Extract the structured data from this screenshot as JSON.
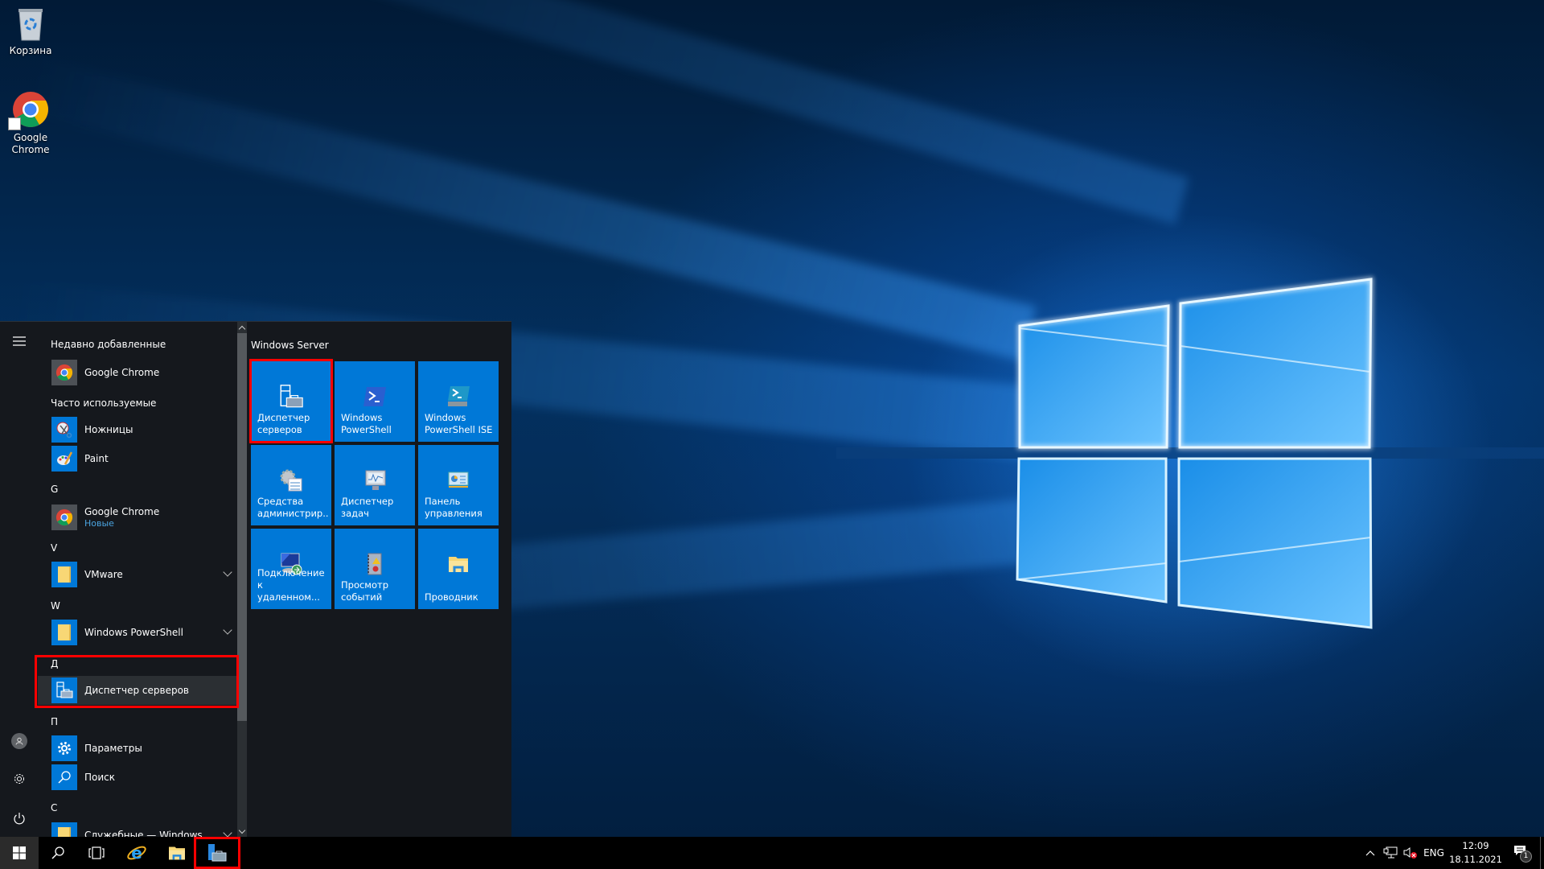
{
  "desktop": {
    "icons": [
      {
        "label": "Корзина",
        "icon": "recycle-bin-icon"
      },
      {
        "label": "Google\nChrome",
        "icon": "chrome-shortcut-icon"
      }
    ]
  },
  "start_menu": {
    "left_strip": {
      "menu": "hamburger-icon",
      "user": "user-avatar-icon",
      "settings": "gear-icon",
      "power": "power-icon"
    },
    "sections": {
      "recent": "Недавно добавленные",
      "frequent": "Часто используемые",
      "g": "G",
      "v": "V",
      "w": "W",
      "d": "Д",
      "p": "П",
      "s": "С"
    },
    "items": {
      "recent_chrome": "Google Chrome",
      "snipping": "Ножницы",
      "paint": "Paint",
      "g_chrome": "Google Chrome",
      "g_chrome_badge": "Новые",
      "vmware": "VMware",
      "powershell_folder": "Windows PowerShell",
      "server_manager": "Диспетчер серверов",
      "settings": "Параметры",
      "search": "Поиск",
      "accessories": "Служебные — Windows"
    },
    "tiles_group": "Windows Server",
    "tiles": [
      {
        "label": "Диспетчер\nсерверов",
        "icon": "server-manager-icon"
      },
      {
        "label": "Windows\nPowerShell",
        "icon": "powershell-icon"
      },
      {
        "label": "Windows\nPowerShell ISE",
        "icon": "powershell-ise-icon"
      },
      {
        "label": "Средства\nадминистрир...",
        "icon": "admin-tools-icon"
      },
      {
        "label": "Диспетчер\nзадач",
        "icon": "task-manager-icon"
      },
      {
        "label": "Панель\nуправления",
        "icon": "control-panel-icon"
      },
      {
        "label": "Подключение\nк удаленном...",
        "icon": "remote-desktop-icon"
      },
      {
        "label": "Просмотр\nсобытий",
        "icon": "event-viewer-icon"
      },
      {
        "label": "Проводник",
        "icon": "file-explorer-icon"
      }
    ]
  },
  "taskbar": {
    "pinned": [
      "start-button",
      "search-button",
      "task-view-button",
      "internet-explorer",
      "file-explorer",
      "server-manager"
    ],
    "tray": {
      "language": "ENG",
      "time": "12:09",
      "date": "18.11.2021",
      "notifications_count": "1"
    }
  },
  "colors": {
    "accent": "#0078d7",
    "highlight": "#ff0000",
    "menu_bg": "#15181d",
    "badge_text": "#4aa3df"
  }
}
